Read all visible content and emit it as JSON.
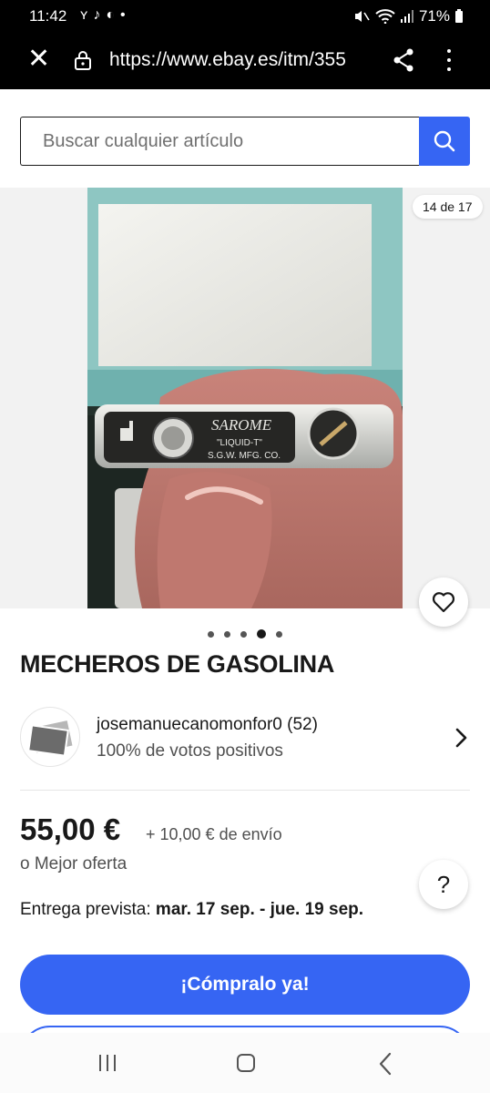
{
  "status_bar": {
    "time": "11:42",
    "app_icons": [
      "instagram-threads-icon",
      "tiktok-icon",
      "messenger-icon"
    ],
    "notification_dot": "•",
    "battery_percent": "71%",
    "icons": [
      "mute-icon",
      "wifi-icon",
      "signal-icon",
      "battery-icon"
    ]
  },
  "browser": {
    "url": "https://www.ebay.es/itm/355",
    "close_icon": "close-icon",
    "lock_icon": "lock-icon",
    "share_icon": "share-icon",
    "menu_icon": "more-vert-icon"
  },
  "search": {
    "placeholder": "Buscar cualquier artículo",
    "button_icon": "search-icon",
    "accent_color": "#3665f3"
  },
  "gallery": {
    "counter": "14 de 17",
    "dots_total": 5,
    "active_dot": 4
  },
  "listing": {
    "title": "MECHEROS DE GASOLINA",
    "seller": {
      "name": "josemanuecanomonfor0 (52)",
      "feedback": "100% de votos positivos"
    },
    "price": "55,00 €",
    "shipping": "+ 10,00 € de envío",
    "best_offer": "o Mejor oferta",
    "delivery_label": "Entrega prevista:",
    "delivery_dates": "mar. 17 sep. - jue. 19 sep.",
    "help_label": "?",
    "buy_now": "¡Cómpralo ya!"
  },
  "product_photo": {
    "engraving_brand": "SAROME",
    "engraving_line2": "\"LIQUID-T\"",
    "engraving_line3": "S.G.W. MFG. CO."
  },
  "nav_bar": {
    "icons": [
      "recents-icon",
      "home-icon",
      "back-icon"
    ]
  }
}
